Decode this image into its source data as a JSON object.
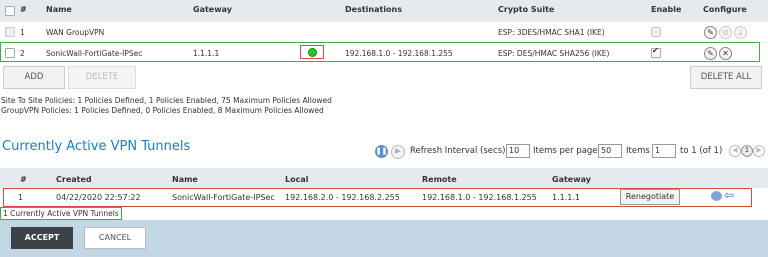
{
  "policy_table": {
    "headers": {
      "index": "#",
      "name": "Name",
      "gateway": "Gateway",
      "destinations": "Destinations",
      "crypto": "Crypto Suite",
      "enable": "Enable",
      "configure": "Configure"
    },
    "rows": [
      {
        "index": "1",
        "name": "WAN GroupVPN",
        "gateway": "",
        "destinations": "",
        "crypto": "ESP: 3DES/HMAC SHA1 (IKE)",
        "enabled": false
      },
      {
        "index": "2",
        "name": "SonicWall-FortiGate-IPSec",
        "gateway": "1.1.1.1",
        "destinations": "192.168.1.0 - 192.168.1.255",
        "crypto": "ESP: DES/HMAC SHA256 (IKE)",
        "enabled": true
      }
    ]
  },
  "buttons": {
    "add": "ADD",
    "delete": "DELETE",
    "delete_all": "DELETE ALL"
  },
  "info": {
    "site_to_site": "Site To Site Policies: 1 Policies Defined, 1 Policies Enabled, 75 Maximum Policies Allowed",
    "groupvpn": "GroupVPN Policies: 1 Policies Defined, 0 Policies Enabled, 8 Maximum Policies Allowed"
  },
  "tunnels": {
    "title": "Currently Active VPN Tunnels",
    "refresh_label": "Refresh Interval (secs)",
    "refresh_value": "10",
    "per_page_label": "Items per page",
    "per_page_value": "50",
    "items_label": "Items",
    "items_value": "1",
    "range_label": "to 1 (of 1)",
    "page_value": "1",
    "headers": {
      "index": "#",
      "created": "Created",
      "name": "Name",
      "local": "Local",
      "remote": "Remote",
      "gateway": "Gateway"
    },
    "rows": [
      {
        "index": "1",
        "created": "04/22/2020 22:57:22",
        "name": "SonicWall-FortiGate-IPSec",
        "local": "192.168.2.0 - 192.168.2.255",
        "remote": "192.168.1.0 - 192.168.1.255",
        "gateway": "1.1.1.1",
        "action": "Renegotiate"
      }
    ],
    "summary": "1 Currently Active VPN Tunnels"
  },
  "footer": {
    "accept": "ACCEPT",
    "cancel": "CANCEL"
  },
  "colors": {
    "accent_blue": "#1f7cbf",
    "highlight_green": "#37b34a",
    "highlight_red": "#e04848",
    "status_dot": "#22cc22",
    "footer_bg": "#c3d6e3"
  }
}
